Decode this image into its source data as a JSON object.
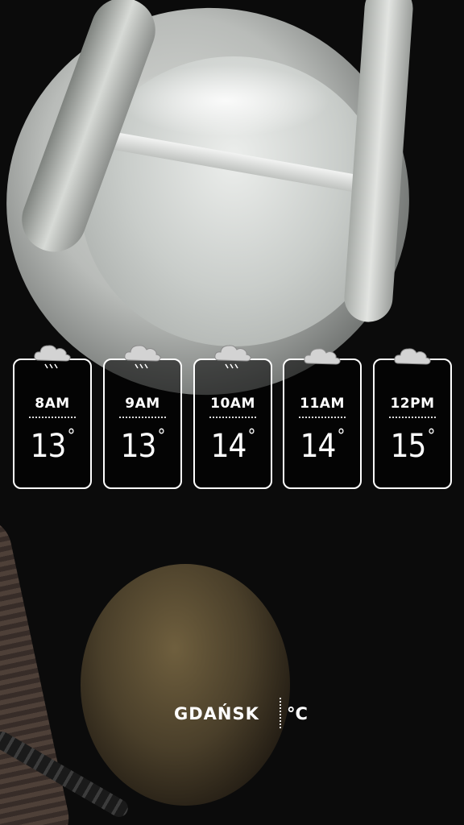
{
  "forecast": [
    {
      "time": "8AM",
      "temp": "13",
      "icon": "cloud-rain-icon"
    },
    {
      "time": "9AM",
      "temp": "13",
      "icon": "cloud-rain-icon"
    },
    {
      "time": "10AM",
      "temp": "14",
      "icon": "cloud-rain-icon"
    },
    {
      "time": "11AM",
      "temp": "14",
      "icon": "cloud-icon"
    },
    {
      "time": "12PM",
      "temp": "15",
      "icon": "cloud-icon"
    }
  ],
  "degree_symbol": "°",
  "location": {
    "city": "GDAŃSK"
  },
  "units": {
    "label": "°C"
  },
  "colors": {
    "text": "#ffffff",
    "cloud": "#cfcfcf"
  }
}
